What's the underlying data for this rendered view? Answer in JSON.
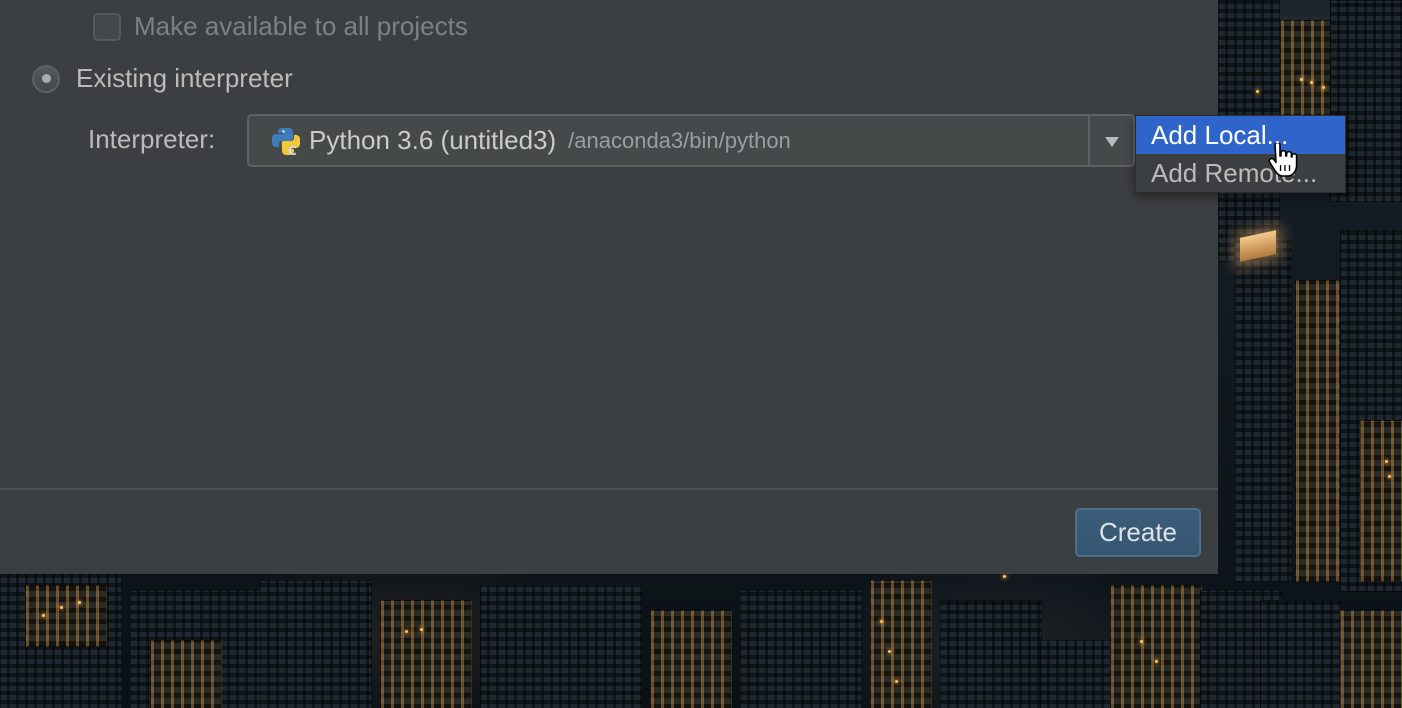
{
  "dialog": {
    "make_available_checkbox": {
      "label": "Make available to all projects",
      "checked": false,
      "enabled": false
    },
    "existing_interpreter_radio": {
      "label": "Existing interpreter",
      "selected": true
    },
    "interpreter": {
      "label": "Interpreter:",
      "selected_name": "Python 3.6 (untitled3)",
      "selected_path": "/anaconda3/bin/python",
      "icon": "python-conda-icon"
    },
    "popup_menu": {
      "items": [
        {
          "label": "Add Local...",
          "highlighted": true
        },
        {
          "label": "Add Remote...",
          "highlighted": false
        }
      ]
    },
    "footer": {
      "create_label": "Create"
    }
  },
  "colors": {
    "dialog_background": "#3c3f41",
    "menu_highlight": "#2f65ca",
    "primary_button": "#365672"
  }
}
